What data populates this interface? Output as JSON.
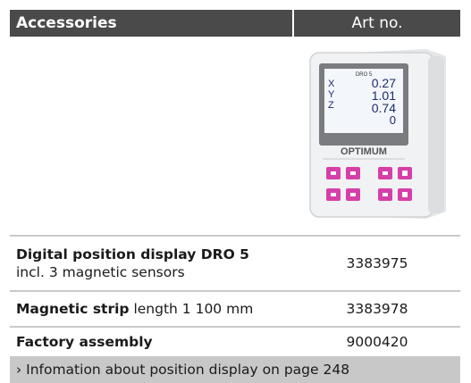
{
  "header": {
    "accessories": "Accessories",
    "art_no": "Art no."
  },
  "device": {
    "screen_title": "DRO 5",
    "axes": [
      {
        "label": "X",
        "value": "0.27"
      },
      {
        "label": "Y",
        "value": "1.01"
      },
      {
        "label": "Z",
        "value": "0.74"
      },
      {
        "label": "",
        "value": "0"
      }
    ],
    "brand": "OPTIMUM"
  },
  "rows": [
    {
      "name_bold": "Digital position display DRO 5",
      "name_rest": "incl. 3 magnetic sensors",
      "art_no": "3383975"
    },
    {
      "name_bold": "Magnetic strip",
      "name_rest": " length 1 100 mm",
      "art_no": "3383978"
    },
    {
      "name_bold": "Factory assembly",
      "name_rest": "",
      "art_no": "9000420"
    }
  ],
  "note": "› Infomation about position display on page 248",
  "colors": {
    "header_bg": "#4a4a4a",
    "note_bg": "#c8c8c8",
    "key_pink": "#d63fa8"
  }
}
